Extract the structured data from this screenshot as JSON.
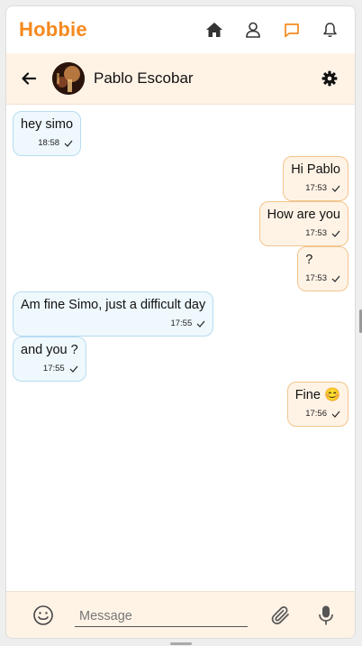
{
  "app": {
    "title": "Hobbie"
  },
  "nav": {
    "icons": [
      "home-icon",
      "user-icon",
      "chat-icon",
      "bell-icon"
    ],
    "active": "chat-icon",
    "accent_color": "#f5891e"
  },
  "chat": {
    "contact_name": "Pablo Escobar"
  },
  "messages": [
    {
      "direction": "in",
      "text": "hey simo",
      "time": "18:58"
    },
    {
      "direction": "out",
      "text": "Hi Pablo",
      "time": "17:53"
    },
    {
      "direction": "out",
      "text": "How are you",
      "time": "17:53"
    },
    {
      "direction": "out",
      "text": "?",
      "time": "17:53"
    },
    {
      "direction": "in",
      "text": "Am fine Simo, just a difficult day",
      "time": "17:55"
    },
    {
      "direction": "in",
      "text": "and you ?",
      "time": "17:55"
    },
    {
      "direction": "out",
      "text": "Fine 😊",
      "time": "17:56"
    }
  ],
  "composer": {
    "placeholder": "Message"
  },
  "colors": {
    "incoming_bg": "#eef8fd",
    "incoming_border": "#b9dcef",
    "outgoing_bg": "#fff3e6",
    "outgoing_border": "#f2c58d",
    "header_bg": "#fff3e6"
  }
}
